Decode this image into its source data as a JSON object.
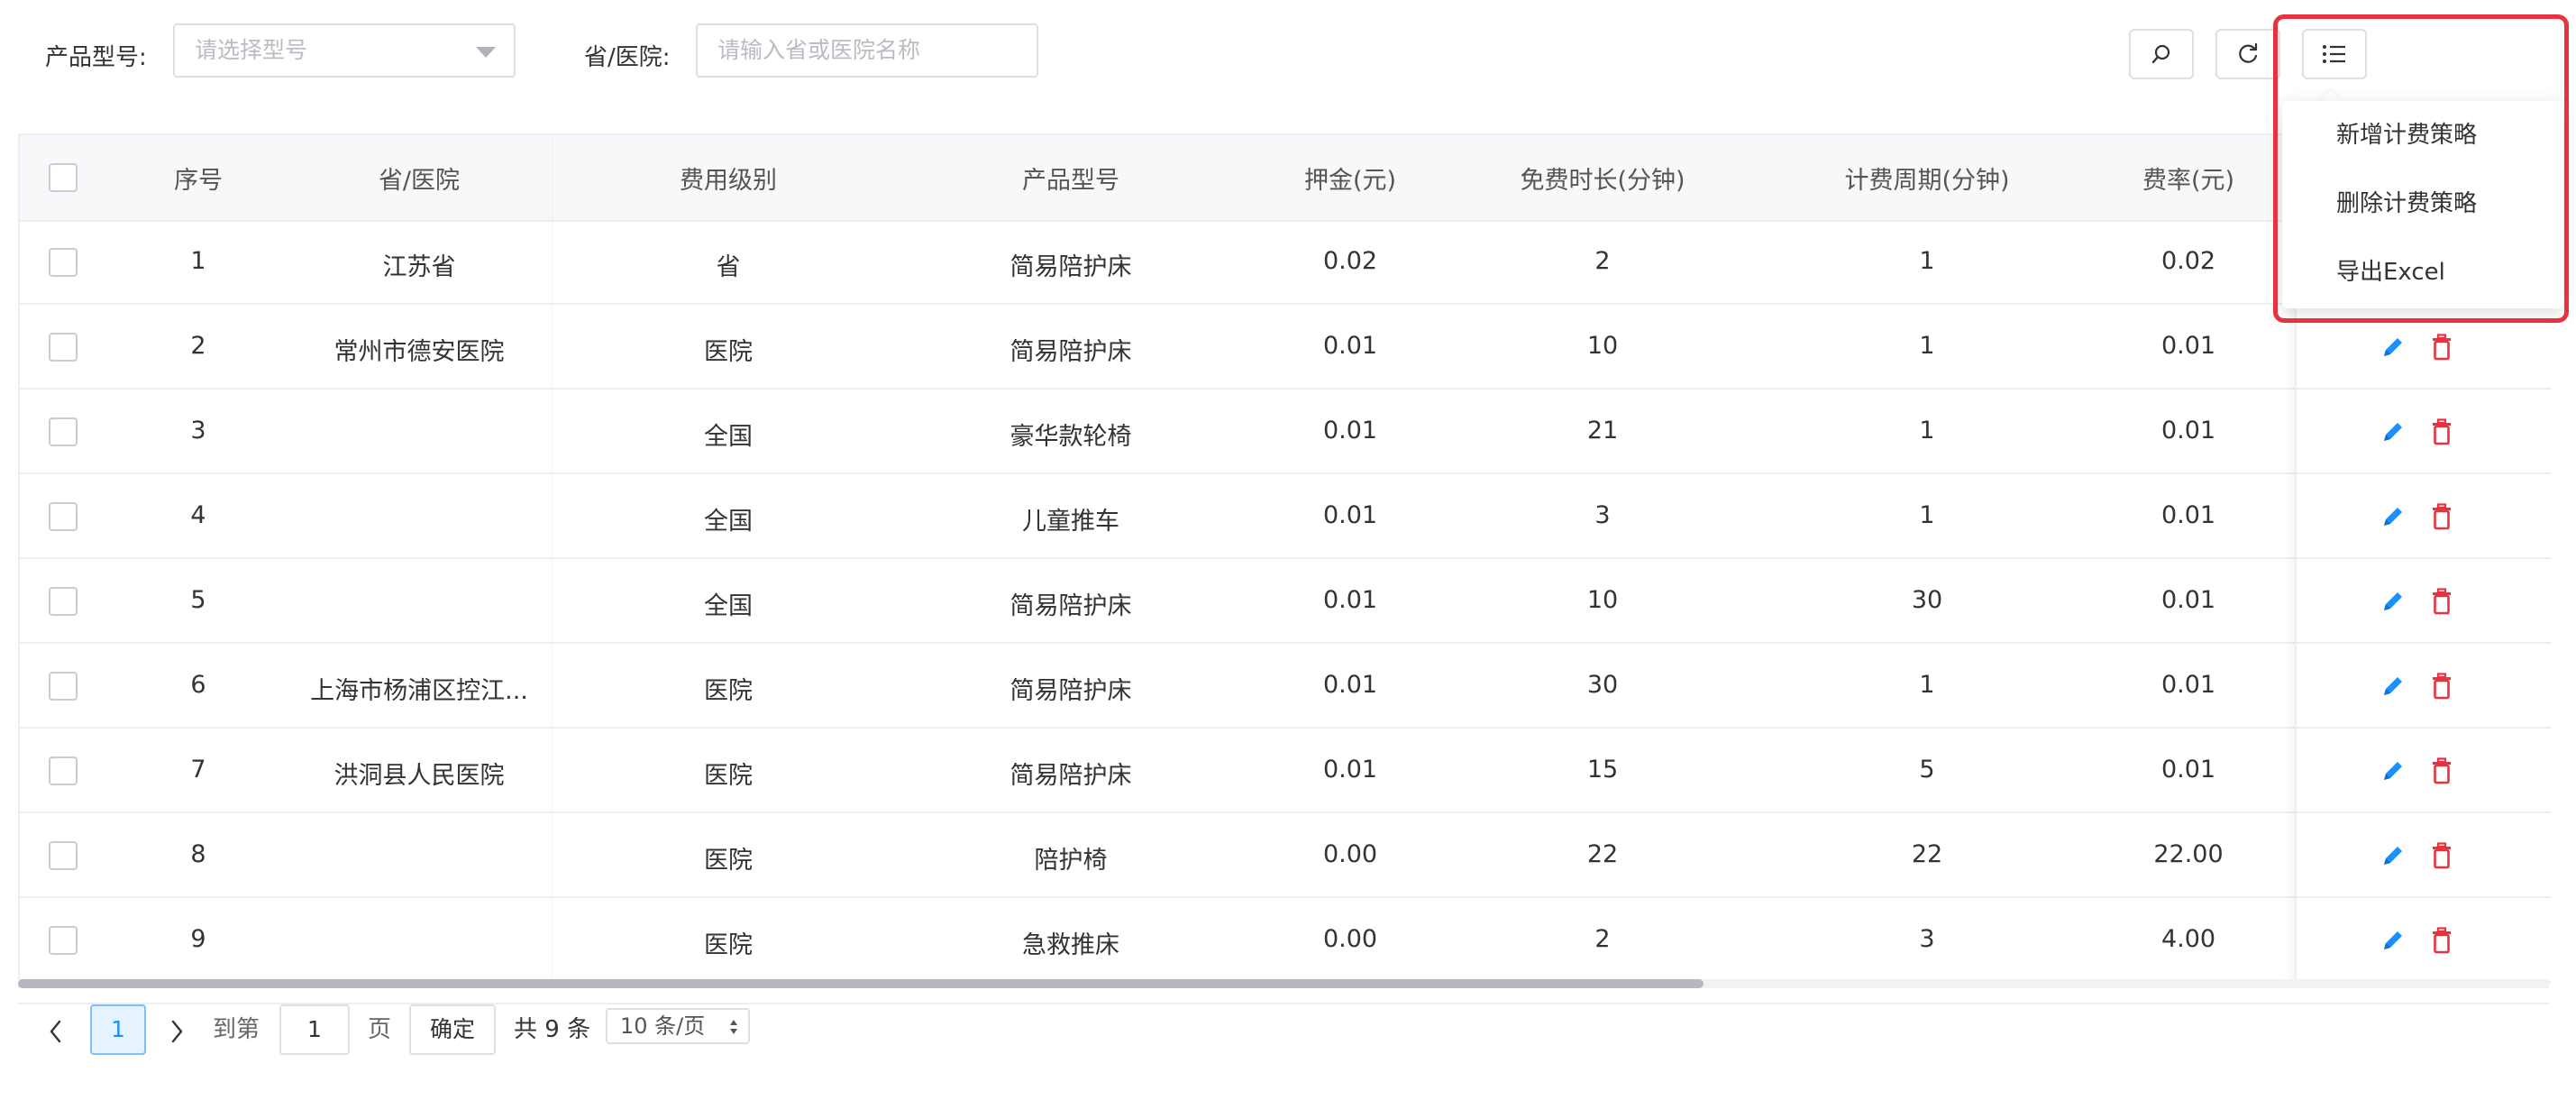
{
  "filters": {
    "product_label": "产品型号:",
    "product_placeholder": "请选择型号",
    "province_label": "省/医院:",
    "province_placeholder": "请输入省或医院名称"
  },
  "menu": {
    "items": [
      "新增计费策略",
      "删除计费策略",
      "导出Excel"
    ]
  },
  "table": {
    "headers": [
      "序号",
      "省/医院",
      "费用级别",
      "产品型号",
      "押金(元)",
      "免费时长(分钟)",
      "计费周期(分钟)",
      "费率(元)"
    ],
    "rows": [
      [
        "1",
        "江苏省",
        "省",
        "简易陪护床",
        "0.02",
        "2",
        "1",
        "0.02"
      ],
      [
        "2",
        "常州市德安医院",
        "医院",
        "简易陪护床",
        "0.01",
        "10",
        "1",
        "0.01"
      ],
      [
        "3",
        "",
        "全国",
        "豪华款轮椅",
        "0.01",
        "21",
        "1",
        "0.01"
      ],
      [
        "4",
        "",
        "全国",
        "儿童推车",
        "0.01",
        "3",
        "1",
        "0.01"
      ],
      [
        "5",
        "",
        "全国",
        "简易陪护床",
        "0.01",
        "10",
        "30",
        "0.01"
      ],
      [
        "6",
        "上海市杨浦区控江...",
        "医院",
        "简易陪护床",
        "0.01",
        "30",
        "1",
        "0.01"
      ],
      [
        "7",
        "洪洞县人民医院",
        "医院",
        "简易陪护床",
        "0.01",
        "15",
        "5",
        "0.01"
      ],
      [
        "8",
        "",
        "医院",
        "陪护椅",
        "0.00",
        "22",
        "22",
        "22.00"
      ],
      [
        "9",
        "",
        "医院",
        "急救推床",
        "0.00",
        "2",
        "3",
        "4.00"
      ]
    ]
  },
  "pagination": {
    "current_page": "1",
    "goto_label": "到第",
    "goto_value": "1",
    "page_unit": "页",
    "confirm_label": "确定",
    "total_text": "共 9 条",
    "page_size": "10 条/页"
  },
  "colors": {
    "accent": "#1890ff",
    "danger": "#e8323f",
    "highlight": "#e8323f"
  },
  "icons": {
    "search": "search-icon",
    "refresh": "refresh-icon",
    "menu": "list-menu-icon",
    "edit": "edit-icon",
    "delete": "trash-icon"
  }
}
